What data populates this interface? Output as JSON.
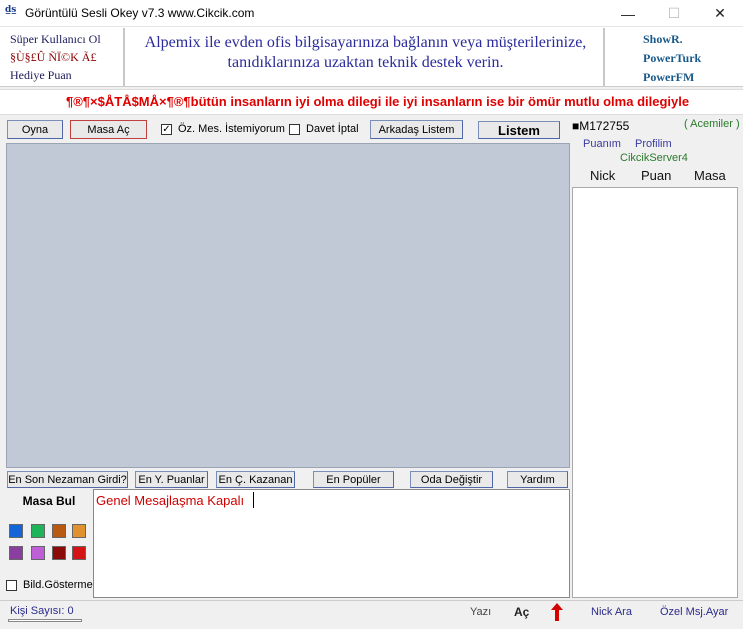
{
  "window": {
    "title": "Görüntülü Sesli Okey v7.3 www.Cikcik.com",
    "icon_text": "d̲s̲",
    "minimize": "—",
    "maximize": "☐",
    "close": "✕"
  },
  "banner": {
    "left_links": [
      "Süper Kullanıcı Ol",
      "§Ù§£Û ÑÏ©K Ã£",
      "Hediye Puan"
    ],
    "ad_text": "Alpemix ile evden ofis bilgisayarınıza bağlanın veya müşterilerinize, tanıdıklarınıza uzaktan teknik destek verin.",
    "radio_links": [
      "ShowR.",
      "PowerTurk",
      "PowerFM"
    ]
  },
  "marquee": {
    "text": "¶®¶×$ÅTÅ$MÅ×¶®¶bütün insanların iyi olma dilegi ile iyi insanların ise bir ömür mutlu olma dilegiyle"
  },
  "toolbar": {
    "oyna": "Oyna",
    "masa_ac": "Masa Aç",
    "oz_mes_label": "Öz. Mes. İstemiyorum",
    "oz_mes_checked": "✓",
    "davet_label": "Davet İptal",
    "arkadas": "Arkadaş Listem",
    "listem": "Listem"
  },
  "right_panel": {
    "user": "■M172755",
    "rank": "( Acemiler )",
    "puanim": "Puanım",
    "profilim": "Profilim",
    "server": "CikcikServer4",
    "columns": [
      "Nick",
      "Puan",
      "Masa"
    ]
  },
  "bottom_buttons": [
    "En Son Nezaman Girdi?",
    "En Y. Puanlar",
    "En Ç. Kazanan",
    "En Popüler",
    "Oda Değiştir",
    "Yardım"
  ],
  "chat": {
    "masa_bul": "Masa Bul",
    "swatches": [
      "#1565d8",
      "#1fb35a",
      "#b85a12",
      "#e0922e",
      "#8a3fa0",
      "#bf5fd6",
      "#8c0a0a",
      "#d41414"
    ],
    "bild_label": "Bild.Gösterme",
    "message": "Genel Mesajlaşma Kapalı"
  },
  "status": {
    "kisi": "Kişi Sayısı: 0",
    "yazi": "Yazı",
    "ac": "Aç",
    "nick_ara": "Nick Ara",
    "ozel_msj": "Özel Msj.Ayar"
  }
}
